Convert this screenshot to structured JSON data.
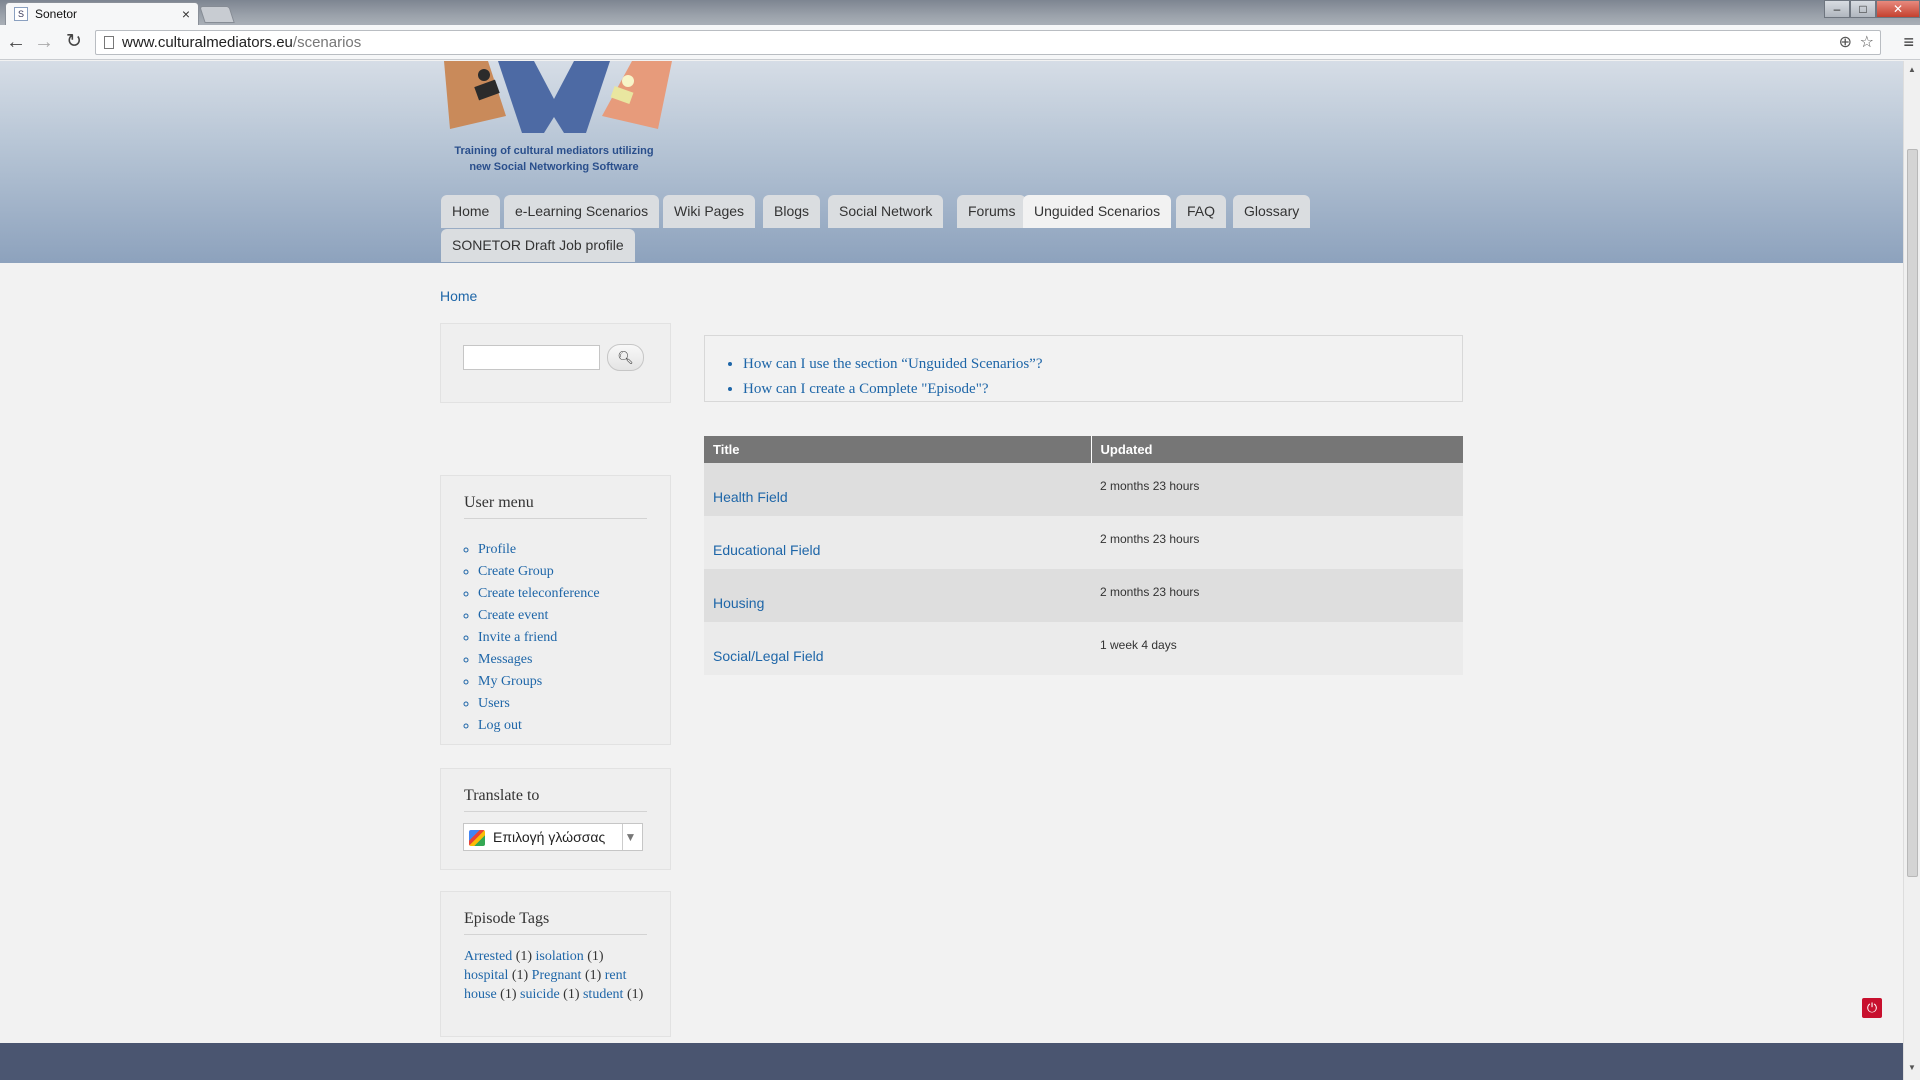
{
  "browser": {
    "tab_title": "Sonetor",
    "tab_close": "×",
    "favicon": "S",
    "url_domain": "www.culturalmediators.eu",
    "url_path": "/scenarios",
    "icons": {
      "back": "back-arrow-icon",
      "forward": "forward-arrow-icon",
      "reload": "reload-icon",
      "page": "page-icon",
      "zoom": "zoom-icon",
      "bookmark": "star-icon",
      "menu": "hamburger-menu-icon"
    }
  },
  "window_controls": {
    "minimize": "–",
    "maximize": "□",
    "close": "✕"
  },
  "header": {
    "slogan_line1": "Training of cultural mediators utilizing",
    "slogan_line2": "new Social Networking Software"
  },
  "nav": {
    "tabs": [
      {
        "label": "Home"
      },
      {
        "label": "e-Learning Scenarios"
      },
      {
        "label": "Wiki Pages"
      },
      {
        "label": "Blogs"
      },
      {
        "label": "Social Network"
      },
      {
        "label": "Forums"
      },
      {
        "label": "Unguided Scenarios",
        "active": true
      },
      {
        "label": "FAQ"
      },
      {
        "label": "Glossary"
      },
      {
        "label": "SONETOR Draft Job profile"
      }
    ]
  },
  "breadcrumb": {
    "home": "Home"
  },
  "search": {
    "value": "",
    "button_icon": "search-icon"
  },
  "user_menu": {
    "title": "User menu",
    "items": [
      "Profile",
      "Create Group",
      "Create teleconference",
      "Create event",
      "Invite a friend",
      "Messages",
      "My Groups",
      "Users",
      "Log out"
    ]
  },
  "translate": {
    "title": "Translate to",
    "selected": "Επιλογή γλώσσας",
    "caret": "▼"
  },
  "episode_tags": {
    "title": "Episode Tags",
    "tags": [
      {
        "name": "Arrested",
        "count": "(1)"
      },
      {
        "name": "isolation",
        "count": "(1)"
      },
      {
        "name": "hospital",
        "count": "(1)"
      },
      {
        "name": "Pregnant",
        "count": "(1)"
      },
      {
        "name": "rent house",
        "count": "(1)"
      },
      {
        "name": "suicide",
        "count": "(1)"
      },
      {
        "name": "student",
        "count": "(1)"
      }
    ]
  },
  "help": {
    "links": [
      "How can I use the section “Unguided Scenarios”?",
      "How can I create a Complete \"Episode\"?"
    ]
  },
  "scenarios_table": {
    "columns": [
      "Title",
      "Updated"
    ],
    "rows": [
      {
        "title": "Health Field",
        "updated": "2 months 23 hours"
      },
      {
        "title": "Educational Field",
        "updated": "2 months 23 hours"
      },
      {
        "title": "Housing",
        "updated": "2 months 23 hours"
      },
      {
        "title": "Social/Legal Field",
        "updated": "1 week 4 days"
      }
    ]
  },
  "footer": {
    "power_icon": "power-icon",
    "power_glyph": "⏻"
  }
}
